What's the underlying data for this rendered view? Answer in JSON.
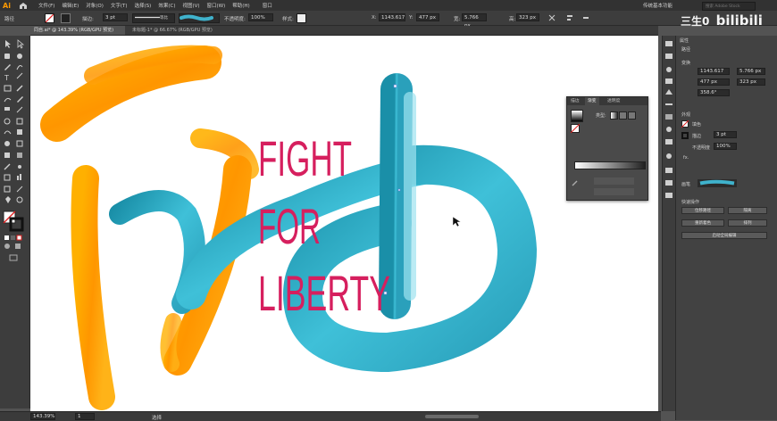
{
  "menubar": {
    "logo": "Ai",
    "items": [
      "文件(F)",
      "编辑(E)",
      "对象(O)",
      "文字(T)",
      "选择(S)",
      "效果(C)",
      "视图(V)",
      "窗口(W)",
      "帮助(H)",
      "窗口"
    ],
    "workspace": "传统基本功能",
    "search_placeholder": "搜索 Adobe Stock"
  },
  "control_bar": {
    "selection_label": "路径",
    "stroke_label": "描边:",
    "stroke_value": "3 pt",
    "profile_label": "等比",
    "opacity_label": "不透明度:",
    "opacity_value": "100%",
    "style_label": "样式:",
    "x_label": "X:",
    "x_value": "1143.617",
    "y_label": "Y:",
    "y_value": "477 px",
    "w_label": "宽:",
    "w_value": "5.766 px",
    "h_label": "高:",
    "h_value": "323 px"
  },
  "doc_tabs": [
    {
      "label": "同自.ai* @ 143.39% (RGB/GPU 预览)",
      "active": true
    },
    {
      "label": "未标题-1* @ 66.67% (RGB/GPU 预览)",
      "active": false
    }
  ],
  "canvas": {
    "headline_lines": [
      "FIGHT",
      "FOR",
      "LIBERTY"
    ]
  },
  "status_bar": {
    "zoom": "143.39%",
    "artboard": "1",
    "tool_hint": "选择"
  },
  "gradient_panel": {
    "tabs": [
      "描边",
      "渐变",
      "透明度"
    ],
    "type_label": "类型:",
    "active_tab_index": 1
  },
  "properties_panel": {
    "header": "属性",
    "sec_path": "路径",
    "sec_transform": "变换",
    "x_value": "1143.617",
    "w_value": "5.766 px",
    "y_value": "477 px",
    "h_value": "323 px",
    "angle_value": "358.6°",
    "sec_appearance": "外观",
    "fill_label": "填色",
    "stroke_label": "描边",
    "stroke_value": "3 pt",
    "opacity_label": "不透明度",
    "opacity_value": "100%",
    "fx_label": "fx.",
    "brush_label": "画笔",
    "sec_quick": "快速操作",
    "btn_offset": "位移路径",
    "btn_group": "隔离",
    "btn_recolor": "重新着色",
    "btn_arrange": "排列",
    "btn_style": "启动全局编辑"
  },
  "watermark": {
    "channel": "三生0",
    "site": "bilibili"
  },
  "colors": {
    "accent_orange": "#ff9a00",
    "teal": "#2aa8c4",
    "magenta": "#d61f5e"
  }
}
